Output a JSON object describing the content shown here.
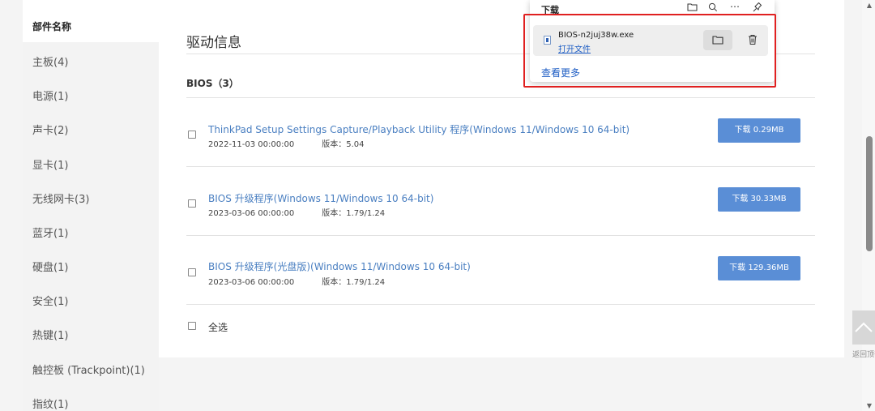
{
  "sidebar": {
    "header": "部件名称",
    "items": [
      {
        "label": "主板(4)"
      },
      {
        "label": "电源(1)"
      },
      {
        "label": "声卡(2)"
      },
      {
        "label": "显卡(1)"
      },
      {
        "label": "无线网卡(3)"
      },
      {
        "label": "蓝牙(1)"
      },
      {
        "label": "硬盘(1)"
      },
      {
        "label": "安全(1)"
      },
      {
        "label": "热键(1)"
      },
      {
        "label": "触控板 (Trackpoint)(1)"
      },
      {
        "label": "指纹(1)"
      }
    ]
  },
  "main": {
    "title": "驱动信息",
    "section": "BIOS（3）",
    "drivers": [
      {
        "title": "ThinkPad Setup Settings Capture/Playback Utility 程序(Windows 11/Windows 10 64-bit)",
        "date": "2022-11-03 00:00:00",
        "version": "版本：5.04",
        "button": "下载 0.29MB"
      },
      {
        "title": "BIOS 升级程序(Windows 11/Windows 10 64-bit)",
        "date": "2023-03-06 00:00:00",
        "version": "版本：1.79/1.24",
        "button": "下载 30.33MB"
      },
      {
        "title": "BIOS 升级程序(光盘版)(Windows 11/Windows 10 64-bit)",
        "date": "2023-03-06 00:00:00",
        "version": "版本：1.79/1.24",
        "button": "下载 129.36MB"
      }
    ],
    "select_all": "全选"
  },
  "download_popup": {
    "title": "下载",
    "file_name": "BIOS-n2juj38w.exe",
    "open_file": "打开文件",
    "see_more": "查看更多"
  },
  "back_to_top": "返回顶部",
  "colors": {
    "accent_link": "#4a7fc1",
    "button_bg": "#5a8ed6",
    "highlight_box": "#e02020"
  }
}
